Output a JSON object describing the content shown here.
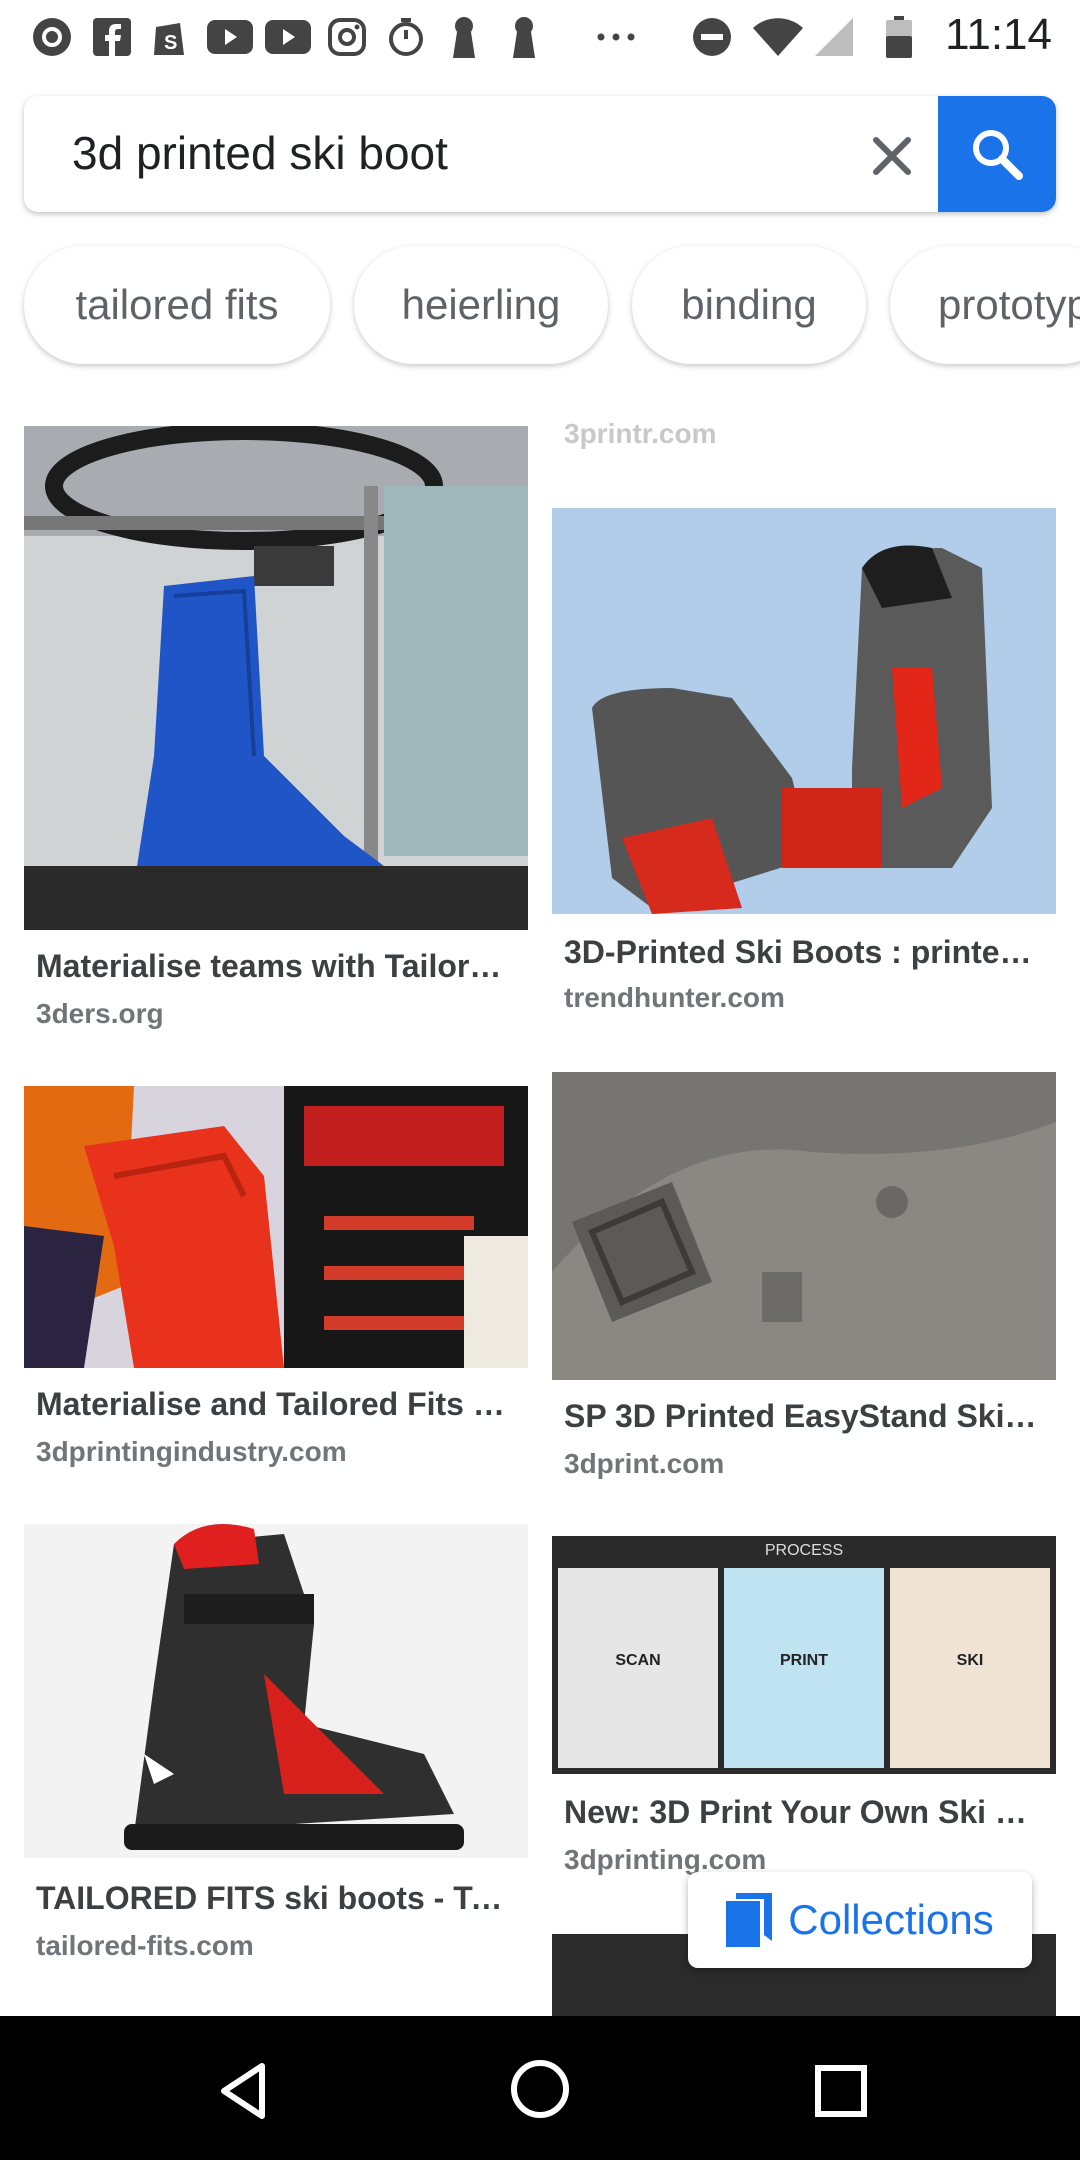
{
  "status_bar": {
    "time": "11:14",
    "left_icons": [
      "pocket-casts-icon",
      "facebook-icon",
      "shopify-icon",
      "youtube-icon",
      "youtube-icon",
      "instagram-icon",
      "timer-icon",
      "keyhole-icon",
      "keyhole-icon",
      "more-icon"
    ],
    "right_icons": [
      "do-not-disturb-icon",
      "wifi-icon",
      "cell-signal-icon",
      "battery-icon"
    ]
  },
  "search": {
    "query": "3d printed ski boot",
    "accent": "#1a73e8"
  },
  "chips": [
    "tailored fits",
    "heierling",
    "binding",
    "prototyp"
  ],
  "partial_source_top_right": "3printr.com",
  "results_left": [
    {
      "title": "Materialise teams with Tailor…",
      "source": "3ders.org"
    },
    {
      "title": "Materialise and Tailored Fits …",
      "source": "3dprintingindustry.com"
    },
    {
      "title": "TAILORED FITS ski boots - Ta…",
      "source": "tailored-fits.com"
    }
  ],
  "results_right": [
    {
      "title": "3D-Printed Ski Boots : printed…",
      "source": "trendhunter.com"
    },
    {
      "title": "SP 3D Printed EasyStand Ski …",
      "source": "3dprint.com"
    },
    {
      "title": "New: 3D Print Your Own Ski B…",
      "source": "3dprinting.com"
    }
  ],
  "image_texts": {
    "process_header": "PROCESS",
    "scan": "SCAN",
    "print": "PRINT",
    "ski": "SKI"
  },
  "collections_label": "Collections"
}
